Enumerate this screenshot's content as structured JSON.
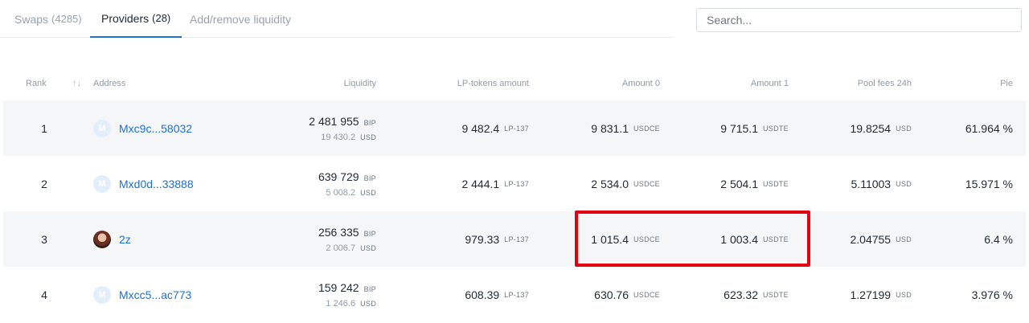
{
  "tabs": [
    {
      "label": "Swaps",
      "count": "(4285)",
      "active": false
    },
    {
      "label": "Providers",
      "count": "(28)",
      "active": true
    },
    {
      "label": "Add/remove liquidity",
      "count": "",
      "active": false
    }
  ],
  "search": {
    "placeholder": "Search..."
  },
  "table": {
    "headers": {
      "rank": "Rank",
      "sort_icon": "↑↓",
      "address": "Address",
      "liquidity": "Liquidity",
      "lp_tokens": "LP-tokens amount",
      "amount0": "Amount 0",
      "amount1": "Amount 1",
      "pool_fees": "Pool fees 24h",
      "pie": "Pie"
    },
    "rows": [
      {
        "rank": "1",
        "address": "Mxc9c...58032",
        "avatar": "minter-logo-icon",
        "liquidity_bip": "2 481 955",
        "liquidity_bip_unit": "BIP",
        "liquidity_usd": "19 430.2",
        "liquidity_usd_unit": "USD",
        "lp": "9 482.4",
        "lp_unit": "LP-137",
        "amount0": "9 831.1",
        "amount0_unit": "USDCE",
        "amount1": "9 715.1",
        "amount1_unit": "USDTE",
        "fees": "19.8254",
        "fees_unit": "USD",
        "pie": "61.964 %"
      },
      {
        "rank": "2",
        "address": "Mxd0d...33888",
        "avatar": "minter-logo-icon",
        "liquidity_bip": "639 729",
        "liquidity_bip_unit": "BIP",
        "liquidity_usd": "5 008.2",
        "liquidity_usd_unit": "USD",
        "lp": "2 444.1",
        "lp_unit": "LP-137",
        "amount0": "2 534.0",
        "amount0_unit": "USDCE",
        "amount1": "2 504.1",
        "amount1_unit": "USDTE",
        "fees": "5.11003",
        "fees_unit": "USD",
        "pie": "15.971 %"
      },
      {
        "rank": "3",
        "address": "2z",
        "avatar": "user-photo-icon",
        "liquidity_bip": "256 335",
        "liquidity_bip_unit": "BIP",
        "liquidity_usd": "2 006.7",
        "liquidity_usd_unit": "USD",
        "lp": "979.33",
        "lp_unit": "LP-137",
        "amount0": "1 015.4",
        "amount0_unit": "USDCE",
        "amount1": "1 003.4",
        "amount1_unit": "USDTE",
        "fees": "2.04755",
        "fees_unit": "USD",
        "pie": "6.4 %"
      },
      {
        "rank": "4",
        "address": "Mxcc5...ac773",
        "avatar": "minter-logo-icon",
        "liquidity_bip": "159 242",
        "liquidity_bip_unit": "BIP",
        "liquidity_usd": "1 246.6",
        "liquidity_usd_unit": "USD",
        "lp": "608.39",
        "lp_unit": "LP-137",
        "amount0": "630.76",
        "amount0_unit": "USDCE",
        "amount1": "623.32",
        "amount1_unit": "USDTE",
        "fees": "1.27199",
        "fees_unit": "USD",
        "pie": "3.976 %"
      }
    ]
  },
  "colors": {
    "accent": "#1d6fd6",
    "highlight": "#e3000f",
    "row_shade": "#f5f6f8"
  }
}
